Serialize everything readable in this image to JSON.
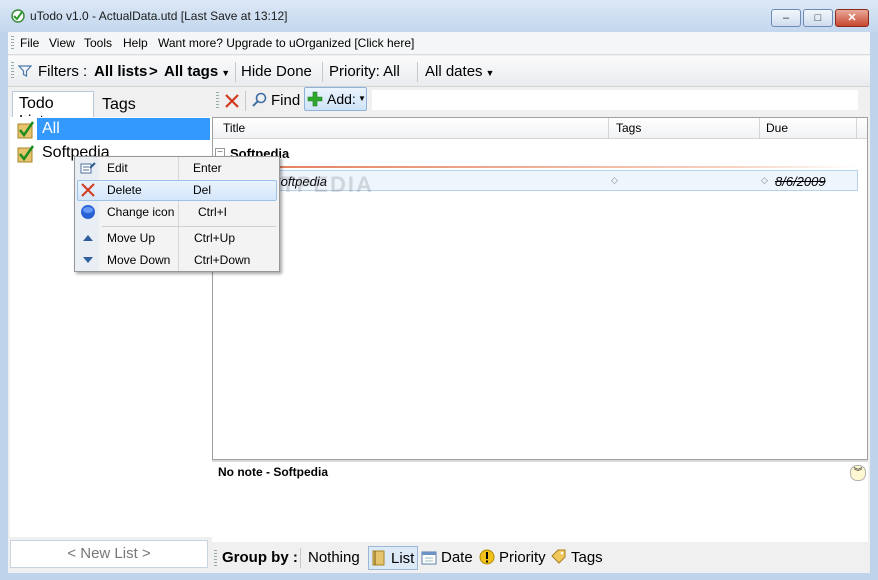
{
  "window": {
    "title": "uTodo v1.0 - ActualData.utd  [Last Save at 13:12]",
    "controls": {
      "minimize": "–",
      "maximize": "□",
      "close": "✕"
    }
  },
  "menubar": {
    "items": [
      "File",
      "View",
      "Tools",
      "Help",
      "Want more? Upgrade to uOrganized [Click here]"
    ]
  },
  "filterbar": {
    "label": "Filters :",
    "lists": "All lists",
    "arrow": ">",
    "tags": "All tags",
    "hide_done": "Hide Done",
    "priority": "Priority: All",
    "dates": "All dates"
  },
  "leftpane": {
    "tabs": [
      "Todo Lists",
      "Tags"
    ],
    "lists": [
      "All",
      "Softpedia"
    ],
    "new_list": "< New List >"
  },
  "toolbar": {
    "find": "Find",
    "add": "Add:"
  },
  "grid": {
    "columns": [
      "Title",
      "Tags",
      "Due"
    ],
    "group": "Softpedia",
    "task": {
      "title": "Softpedia",
      "due": "8/6/2009"
    }
  },
  "notes": {
    "text": "No note - Softpedia"
  },
  "groupbar": {
    "label": "Group by :",
    "options": [
      "Nothing",
      "List",
      "Date",
      "Priority",
      "Tags"
    ]
  },
  "context_menu": {
    "items": [
      {
        "label": "Edit",
        "shortcut": "Enter"
      },
      {
        "label": "Delete",
        "shortcut": "Del"
      },
      {
        "label": "Change icon",
        "shortcut": "Ctrl+I"
      },
      {
        "label": "Move Up",
        "shortcut": "Ctrl+Up"
      },
      {
        "label": "Move Down",
        "shortcut": "Ctrl+Down"
      }
    ]
  },
  "watermark": "SOFTPEDIA",
  "colors": {
    "selection": "#3399ff",
    "accent_red": "#d13a1f",
    "add_green": "#2ea82e"
  }
}
